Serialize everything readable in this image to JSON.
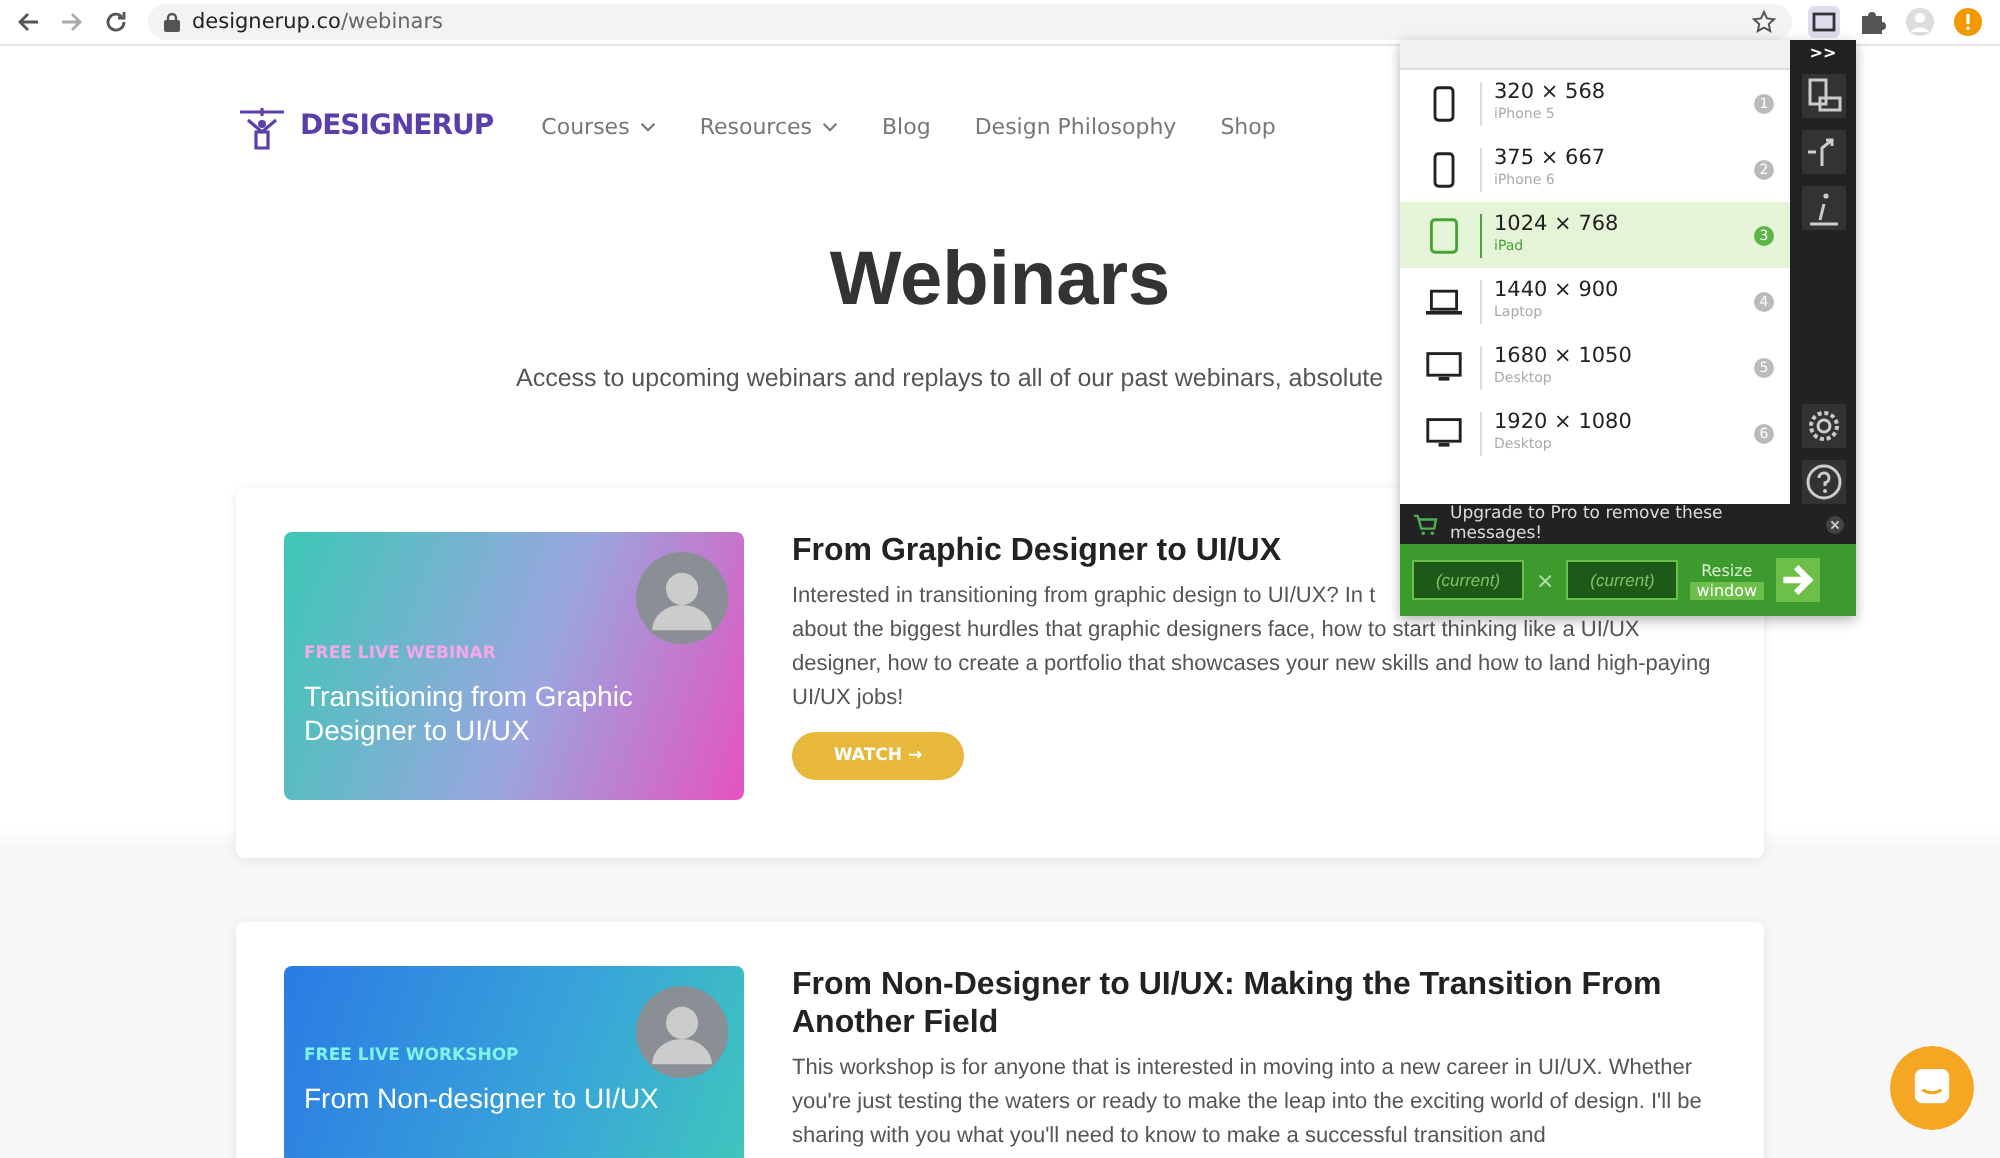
{
  "browser": {
    "url_host": "designerup.co",
    "url_path": "/webinars"
  },
  "site": {
    "logo": "DESIGNERUP",
    "nav": [
      {
        "label": "Courses",
        "dropdown": true
      },
      {
        "label": "Resources",
        "dropdown": true
      },
      {
        "label": "Blog",
        "dropdown": false
      },
      {
        "label": "Design Philosophy",
        "dropdown": false
      },
      {
        "label": "Shop",
        "dropdown": false
      }
    ]
  },
  "page": {
    "title": "Webinars",
    "subtitle": "Access to upcoming webinars and replays to all of our past webinars, absolute"
  },
  "webinars": [
    {
      "banner_tag": "FREE LIVE WEBINAR",
      "banner_title": "Transitioning from Graphic Designer to UI/UX",
      "kind": "pink",
      "title": "From Graphic Designer to UI/UX",
      "description": [
        "Interested in transitioning from graphic design to UI/UX? In t",
        "about the biggest hurdles that graphic designers face, how to start thinking like a UI/UX designer, how to create a portfolio that showcases your new skills and how to land high-paying UI/UX jobs!"
      ],
      "button": "WATCH →"
    },
    {
      "banner_tag": "FREE LIVE WORKSHOP",
      "banner_title": "From Non-designer to UI/UX",
      "kind": "blue",
      "title": "From Non-Designer to UI/UX: Making the Transition From Another Field",
      "description": [
        "This workshop is for anyone that is interested in moving into a new career in UI/UX. Whether you're just testing the waters or ready to make the leap into the exciting world of design. I'll be sharing with you what you'll need to know to make a successful transition and"
      ]
    }
  ],
  "resizer": {
    "devices": [
      {
        "size": "320 × 568",
        "name": "iPhone 5",
        "badge": "1",
        "kind": "phone",
        "selected": false
      },
      {
        "size": "375 × 667",
        "name": "iPhone 6",
        "badge": "2",
        "kind": "phone",
        "selected": false
      },
      {
        "size": "1024 × 768",
        "name": "iPad",
        "badge": "3",
        "kind": "tablet",
        "selected": true
      },
      {
        "size": "1440 × 900",
        "name": "Laptop",
        "badge": "4",
        "kind": "laptop",
        "selected": false
      },
      {
        "size": "1680 × 1050",
        "name": "Desktop",
        "badge": "5",
        "kind": "desktop",
        "selected": false
      },
      {
        "size": "1920 × 1080",
        "name": "Desktop",
        "badge": "6",
        "kind": "desktop",
        "selected": false
      }
    ],
    "collapse": ">>",
    "message": "Upgrade to Pro to remove these messages!",
    "width_placeholder": "(current)",
    "times": "×",
    "height_placeholder": "(current)",
    "resize_label_1": "Resize",
    "resize_label_2": "window"
  }
}
